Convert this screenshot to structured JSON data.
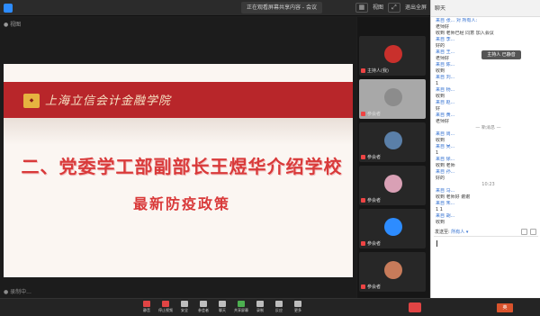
{
  "window": {
    "title": "正在观看屏幕共享内容 - 会议",
    "view_label": "视图",
    "exit_label": "退出全屏"
  },
  "stage": {
    "top_label": "● 视图",
    "bottom_label": "● 录制中..."
  },
  "slide": {
    "school": "上海立信会计金融学院",
    "title_line1": "二、党委学工部副部长王煜华介绍学校",
    "title_line2": "最新防疫政策"
  },
  "participants": [
    {
      "name": "主持人(我)",
      "avatar_color": "#c9302c"
    },
    {
      "name": "参会者",
      "avatar_color": "#8c8c8c",
      "grey": true
    },
    {
      "name": "参会者",
      "avatar_color": "#5a7fa8"
    },
    {
      "name": "参会者",
      "avatar_color": "#d9a0b5"
    },
    {
      "name": "参会者",
      "avatar_color": "#2d8cff"
    },
    {
      "name": "参会者",
      "avatar_color": "#c77b5a"
    }
  ],
  "chat": {
    "header": "聊天",
    "popup": "主持人 已静音",
    "messages": [
      {
        "kind": "sender",
        "text": "来自 张... 对 所有人:"
      },
      {
        "kind": "text",
        "text": "老师好"
      },
      {
        "kind": "text",
        "text": "收到 老师已经 同意 加入会议"
      },
      {
        "kind": "sender",
        "text": "来自 李..."
      },
      {
        "kind": "text",
        "text": "好的"
      },
      {
        "kind": "sender",
        "text": "来自 王..."
      },
      {
        "kind": "text",
        "text": "老师好"
      },
      {
        "kind": "sender",
        "text": "来自 陈..."
      },
      {
        "kind": "text",
        "text": "收到"
      },
      {
        "kind": "sender",
        "text": "来自 刘..."
      },
      {
        "kind": "text",
        "text": "1"
      },
      {
        "kind": "sender",
        "text": "来自 杨..."
      },
      {
        "kind": "text",
        "text": "收到"
      },
      {
        "kind": "sender",
        "text": "来自 赵..."
      },
      {
        "kind": "text",
        "text": "好"
      },
      {
        "kind": "sender",
        "text": "来自 黄..."
      },
      {
        "kind": "text",
        "text": "老师好"
      },
      {
        "kind": "sys",
        "text": "— 新消息 —"
      },
      {
        "kind": "sender",
        "text": "来自 周..."
      },
      {
        "kind": "text",
        "text": "收到"
      },
      {
        "kind": "sender",
        "text": "来自 吴..."
      },
      {
        "kind": "text",
        "text": "1"
      },
      {
        "kind": "sender",
        "text": "来自 徐..."
      },
      {
        "kind": "text",
        "text": "收到 老师"
      },
      {
        "kind": "sender",
        "text": "来自 孙..."
      },
      {
        "kind": "text",
        "text": "好的"
      },
      {
        "kind": "sys",
        "text": "10:23"
      },
      {
        "kind": "sender",
        "text": "来自 马..."
      },
      {
        "kind": "text",
        "text": "收到 老师好 谢谢"
      },
      {
        "kind": "sender",
        "text": "来自 朱..."
      },
      {
        "kind": "text",
        "text": "1 1"
      },
      {
        "kind": "sender",
        "text": "来自 胡..."
      },
      {
        "kind": "text",
        "text": "收到"
      }
    ],
    "to_label": "发送至:",
    "to_target": "所有人 ▾"
  },
  "toolbar": {
    "items": [
      {
        "label": "静音",
        "color": "red"
      },
      {
        "label": "停止视频",
        "color": "red"
      },
      {
        "label": "安全",
        "color": ""
      },
      {
        "label": "参会者",
        "color": ""
      },
      {
        "label": "聊天",
        "color": ""
      },
      {
        "label": "共享屏幕",
        "color": "green"
      },
      {
        "label": "录制",
        "color": ""
      },
      {
        "label": "反应",
        "color": ""
      },
      {
        "label": "更多",
        "color": ""
      }
    ],
    "leave": "结束",
    "badge": "英"
  }
}
